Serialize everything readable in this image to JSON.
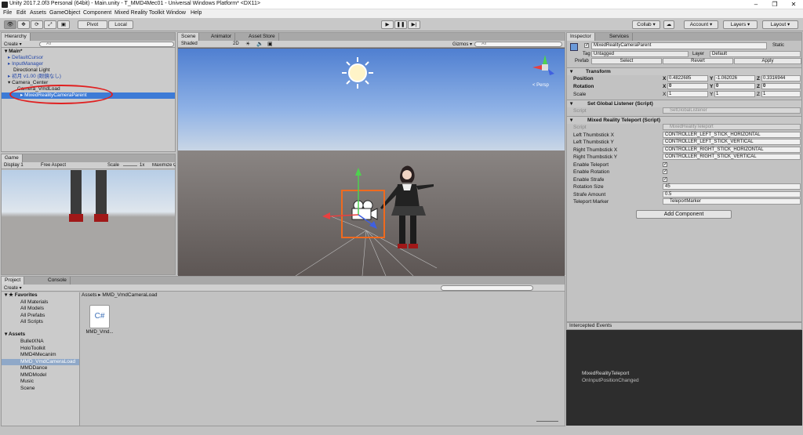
{
  "window": {
    "title": "Unity 2017.2.0f3 Personal (64bit) - Main.unity - T_MMD4Mec01 - Universal Windows Platform* <DX11>"
  },
  "menu": [
    "File",
    "Edit",
    "Assets",
    "GameObject",
    "Component",
    "Mixed Reality Toolkit",
    "Window",
    "Help"
  ],
  "toolbar": {
    "pivot": "Pivot",
    "local": "Local",
    "collab": "Collab ▾",
    "account": "Account ▾",
    "layers": "Layers ▾",
    "layout": "Layout ▾"
  },
  "hierarchy": {
    "tab": "Hierarchy",
    "create": "Create ▾",
    "search": "All",
    "items": [
      {
        "label": "Main*"
      },
      {
        "label": "DefaultCursor"
      },
      {
        "label": "InputManager"
      },
      {
        "label": "Directional Light"
      },
      {
        "label": "初月 v1.00 (眼鏡なし)"
      },
      {
        "label": "Camera_Center"
      },
      {
        "label": "Camera_VmdLoad"
      },
      {
        "label": "MixedRealityCameraParent"
      }
    ]
  },
  "scene": {
    "tabs": [
      "Scene",
      "Animator",
      "Asset Store"
    ],
    "shaded": "Shaded",
    "mode2d": "2D",
    "gizmos": "Gizmos ▾",
    "search": "All",
    "persp": "< Persp"
  },
  "game": {
    "tab": "Game",
    "display": "Display 1",
    "aspect": "Free Aspect",
    "scale_label": "Scale",
    "scale_value": "1x",
    "maximize": "Maximize On Play"
  },
  "inspector": {
    "tabs": [
      "Inspector",
      "Services"
    ],
    "object_name": "MixedRealityCameraParent",
    "static": "Static",
    "tag_label": "Tag",
    "tag": "Untagged",
    "layer_label": "Layer",
    "layer": "Default",
    "prefab_label": "Prefab",
    "prefab_select": "Select",
    "prefab_revert": "Revert",
    "prefab_apply": "Apply",
    "transform": {
      "title": "Transform",
      "position": {
        "label": "Position",
        "x": "0.4822685",
        "y": "-1.062026",
        "z": "0.3316944"
      },
      "rotation": {
        "label": "Rotation",
        "x": "0",
        "y": "0",
        "z": "0"
      },
      "scale": {
        "label": "Scale",
        "x": "1",
        "y": "1",
        "z": "1"
      }
    },
    "sgl": {
      "title": "Set Global Listener (Script)",
      "script_label": "Script",
      "script": "SetGlobalListener"
    },
    "mrt": {
      "title": "Mixed Reality Teleport (Script)",
      "rows": [
        {
          "label": "Script",
          "value": "MixedRealityTeleport"
        },
        {
          "label": "Left Thumbstick X",
          "value": "CONTROLLER_LEFT_STICK_HORIZONTAL"
        },
        {
          "label": "Left Thumbstick Y",
          "value": "CONTROLLER_LEFT_STICK_VERTICAL"
        },
        {
          "label": "Right Thumbstick X",
          "value": "CONTROLLER_RIGHT_STICK_HORIZONTAL"
        },
        {
          "label": "Right Thumbstick Y",
          "value": "CONTROLLER_RIGHT_STICK_VERTICAL"
        },
        {
          "label": "Enable Teleport",
          "value": "✓"
        },
        {
          "label": "Enable Rotation",
          "value": "✓"
        },
        {
          "label": "Enable Strafe",
          "value": "✓"
        },
        {
          "label": "Rotation Size",
          "value": "45"
        },
        {
          "label": "Strafe Amount",
          "value": "0.5"
        },
        {
          "label": "Teleport Marker",
          "value": "TeleportMarker"
        }
      ]
    },
    "add_component": "Add Component"
  },
  "events": {
    "title": "Intercepted Events",
    "line1": "MixedRealityTeleport",
    "line2": "OnInputPositionChanged"
  },
  "project": {
    "tabs": [
      "Project",
      "Console"
    ],
    "create": "Create ▾",
    "breadcrumb": "Assets ▸ MMD_VmdCameraLoad",
    "favorites": {
      "title": "Favorites",
      "items": [
        "All Materials",
        "All Models",
        "All Prefabs",
        "All Scripts"
      ]
    },
    "assets": {
      "title": "Assets",
      "items": [
        "BulletXNA",
        "HoloToolkit",
        "MMD4Mecanim",
        "MMD_VmdCameraLoad",
        "MMDDance",
        "MMDModel",
        "Music",
        "Scene"
      ]
    },
    "file_name": "MMD_Vmd...",
    "file_icon": "C#"
  },
  "colors": {
    "selection": "#3d7bd6",
    "annotation": "#e02020",
    "camera_orange": "#f06a1e"
  }
}
